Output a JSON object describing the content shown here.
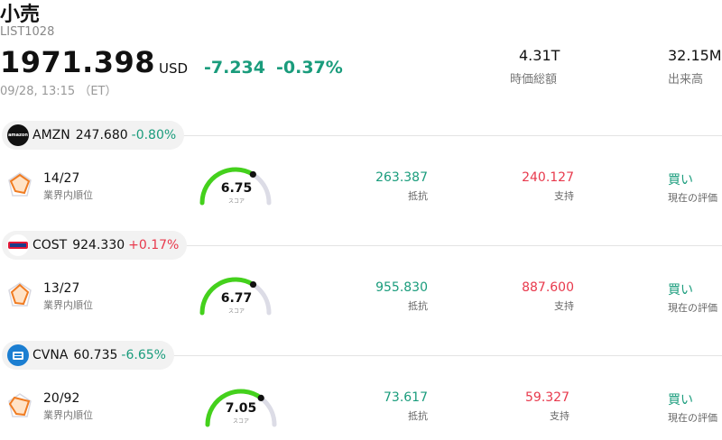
{
  "header": {
    "title": "小売",
    "subtitle": "LIST1028",
    "price": "1971.398",
    "currency": "USD",
    "change": "-7.234",
    "change_pct": "-0.37%",
    "timestamp": "09/28, 13:15 （ET）"
  },
  "stats": {
    "market_cap_value": "4.31T",
    "market_cap_label": "時価総額",
    "volume_value": "32.15M",
    "volume_label": "出来高"
  },
  "colors": {
    "down": "#1a9c7c",
    "up": "#e8394c",
    "gauge_fill": "#44d11c",
    "gauge_track": "#dcdce6"
  },
  "labels": {
    "rank": "業界内順位",
    "score": "スコア",
    "resistance": "抵抗",
    "support": "支持",
    "rating": "現在の評価"
  },
  "stocks": [
    {
      "ticker": "AMZN",
      "price": "247.680",
      "change_pct": "-0.80%",
      "direction": "down",
      "logo_text": "amazon",
      "rank": "14/27",
      "score": "6.75",
      "score_fraction": 0.675,
      "resistance": "263.387",
      "support": "240.127",
      "rating": "買い"
    },
    {
      "ticker": "COST",
      "price": "924.330",
      "change_pct": "+0.17%",
      "direction": "up",
      "logo_text": "COSTCO",
      "rank": "13/27",
      "score": "6.77",
      "score_fraction": 0.677,
      "resistance": "955.830",
      "support": "887.600",
      "rating": "買い"
    },
    {
      "ticker": "CVNA",
      "price": "60.735",
      "change_pct": "-6.65%",
      "direction": "down",
      "logo_text": "",
      "rank": "20/92",
      "score": "7.05",
      "score_fraction": 0.705,
      "resistance": "73.617",
      "support": "59.327",
      "rating": "買い"
    }
  ]
}
